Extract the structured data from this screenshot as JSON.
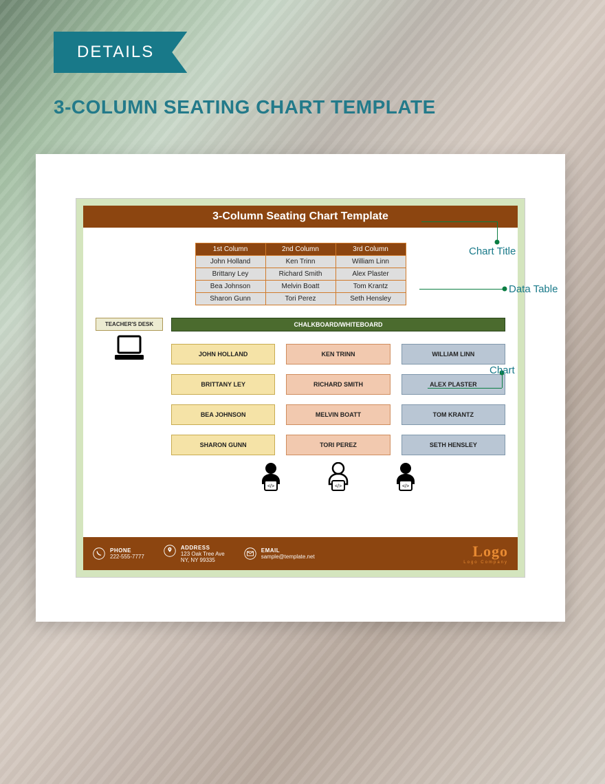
{
  "ribbon": {
    "label": "DETAILS"
  },
  "page_title": "3-COLUMN SEATING CHART TEMPLATE",
  "template": {
    "title": "3-Column Seating Chart Template",
    "columns": [
      "1st Column",
      "2nd Column",
      "3rd Column"
    ],
    "rows": [
      [
        "John Holland",
        "Ken Trinn",
        "William Linn"
      ],
      [
        "Brittany Ley",
        "Richard Smith",
        "Alex Plaster"
      ],
      [
        "Bea Johnson",
        "Melvin Boatt",
        "Tom Krantz"
      ],
      [
        "Sharon Gunn",
        "Tori Perez",
        "Seth Hensley"
      ]
    ],
    "teacher_desk": "TEACHER'S DESK",
    "chalkboard": "CHALKBOARD/WHITEBOARD",
    "seats": [
      [
        "JOHN HOLLAND",
        "KEN TRINN",
        "WILLIAM LINN"
      ],
      [
        "BRITTANY LEY",
        "RICHARD SMITH",
        "ALEX PLASTER"
      ],
      [
        "BEA JOHNSON",
        "MELVIN BOATT",
        "TOM KRANTZ"
      ],
      [
        "SHARON GUNN",
        "TORI PEREZ",
        "SETH HENSLEY"
      ]
    ],
    "footer": {
      "phone_label": "PHONE",
      "phone_value": "222-555-7777",
      "address_label": "ADDRESS",
      "address_line1": "123 Oak Tree Ave",
      "address_line2": "NY, NY 99335",
      "email_label": "EMAIL",
      "email_value": "sample@template.net",
      "logo_big": "Logo",
      "logo_small": "Logo Company"
    }
  },
  "callouts": {
    "chart_title": "Chart Title",
    "data_table": "Data Table",
    "chart": "Chart"
  },
  "colors": {
    "teal": "#187989",
    "brown": "#8c4510",
    "green_leader": "#0a7d42"
  }
}
